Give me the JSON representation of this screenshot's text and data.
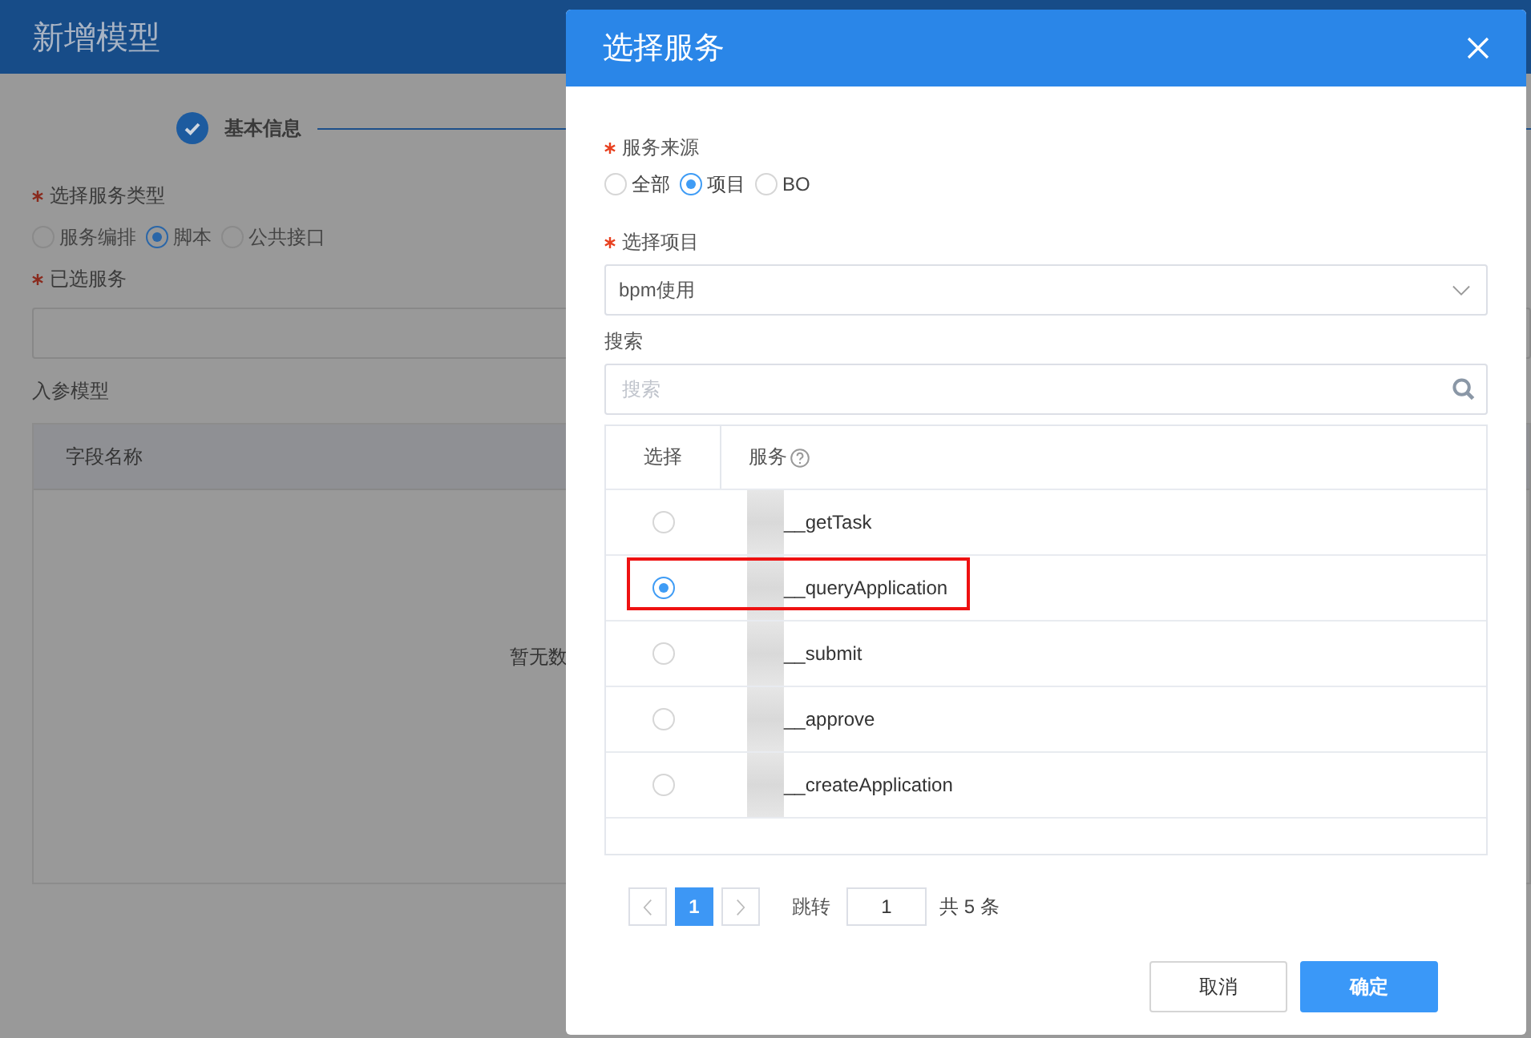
{
  "page": {
    "title": "新增模型",
    "step": {
      "label": "基本信息",
      "done": true
    },
    "service_type": {
      "label": "选择服务类型",
      "required": true,
      "options": [
        {
          "label": "服务编排",
          "selected": false
        },
        {
          "label": "脚本",
          "selected": true
        },
        {
          "label": "公共接口",
          "selected": false
        }
      ]
    },
    "selected_service": {
      "label": "已选服务",
      "required": true
    },
    "params_label": "入参模型",
    "table": {
      "columns": [
        "字段名称"
      ],
      "empty_text": "暂无数"
    }
  },
  "dialog": {
    "title": "选择服务",
    "source": {
      "label": "服务来源",
      "required": true,
      "options": [
        {
          "label": "全部",
          "selected": false
        },
        {
          "label": "项目",
          "selected": true
        },
        {
          "label": "BO",
          "selected": false
        }
      ]
    },
    "project": {
      "label": "选择项目",
      "required": true,
      "value": "bpm使用"
    },
    "search": {
      "label": "搜索",
      "placeholder": "搜索"
    },
    "table": {
      "columns": [
        "选择",
        "服务"
      ],
      "rows": [
        {
          "service": "__getTask",
          "selected": false,
          "highlighted": false
        },
        {
          "service": "__queryApplication",
          "selected": true,
          "highlighted": true
        },
        {
          "service": "__submit",
          "selected": false,
          "highlighted": false
        },
        {
          "service": "__approve",
          "selected": false,
          "highlighted": false
        },
        {
          "service": "__createApplication",
          "selected": false,
          "highlighted": false
        }
      ]
    },
    "pagination": {
      "pages": [
        {
          "label": "1",
          "selected": true
        }
      ],
      "jump_label": "跳转",
      "jump_value": "1",
      "total": "共 5 条"
    },
    "buttons": [
      {
        "label": "取消",
        "kind": "secondary"
      },
      {
        "label": "确定",
        "kind": "primary"
      }
    ]
  }
}
